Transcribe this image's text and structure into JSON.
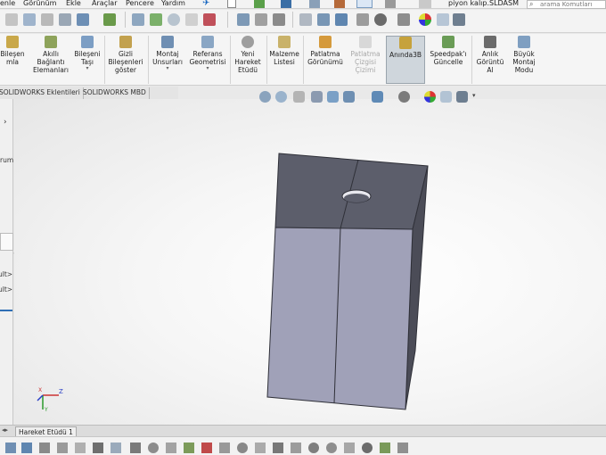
{
  "menu": {
    "items": [
      "Görünüm",
      "Ekle",
      "Araçlar",
      "Pencere",
      "Yardım"
    ],
    "first_partial": "enle",
    "document_title": "piyon kalıp.SLDASM",
    "search_placeholder": "arama Komutları"
  },
  "ribbon": {
    "commands": [
      {
        "label": "Bileşen\nmla",
        "dropdown": false
      },
      {
        "label": "Akıllı\nBağlantı\nElemanları",
        "dropdown": false
      },
      {
        "label": "Bileşeni\nTaşı",
        "dropdown": true
      },
      {
        "label": "Gizli\nBileşenleri\ngöster",
        "dropdown": false
      },
      {
        "label": "Montaj\nUnsurları",
        "dropdown": true
      },
      {
        "label": "Referans\nGeometrisi",
        "dropdown": true
      },
      {
        "label": "Yeni\nHareket\nEtüdü",
        "dropdown": false
      },
      {
        "label": "Malzeme\nListesi",
        "dropdown": false
      },
      {
        "label": "Patlatma\nGörünümü",
        "dropdown": false
      },
      {
        "label": "Patlatma\nÇizgisi\nÇizimi",
        "dropdown": false
      },
      {
        "label": "Anında3B",
        "dropdown": false
      },
      {
        "label": "Speedpak'ı\nGüncelle",
        "dropdown": false
      },
      {
        "label": "Anlık\nGörüntü\nAl",
        "dropdown": false
      },
      {
        "label": "Büyük\nMontaj\nModu",
        "dropdown": false
      }
    ]
  },
  "tabs": {
    "items": [
      "SOLIDWORKS Eklentileri",
      "SOLIDWORKS MBD"
    ]
  },
  "left_panel": {
    "lines": [
      "rum",
      "ult>",
      "ult>"
    ]
  },
  "bottom_tabs": {
    "items": [
      "Hareket Etüdü 1"
    ]
  },
  "triad": {
    "x_label": "X",
    "y_label": "Y",
    "z_label": "Z"
  },
  "colors": {
    "part_top": "#5c5e6b",
    "part_front": "#a0a1b8",
    "part_side": "#4b4c57",
    "active_tool": "#cfd6dc"
  }
}
